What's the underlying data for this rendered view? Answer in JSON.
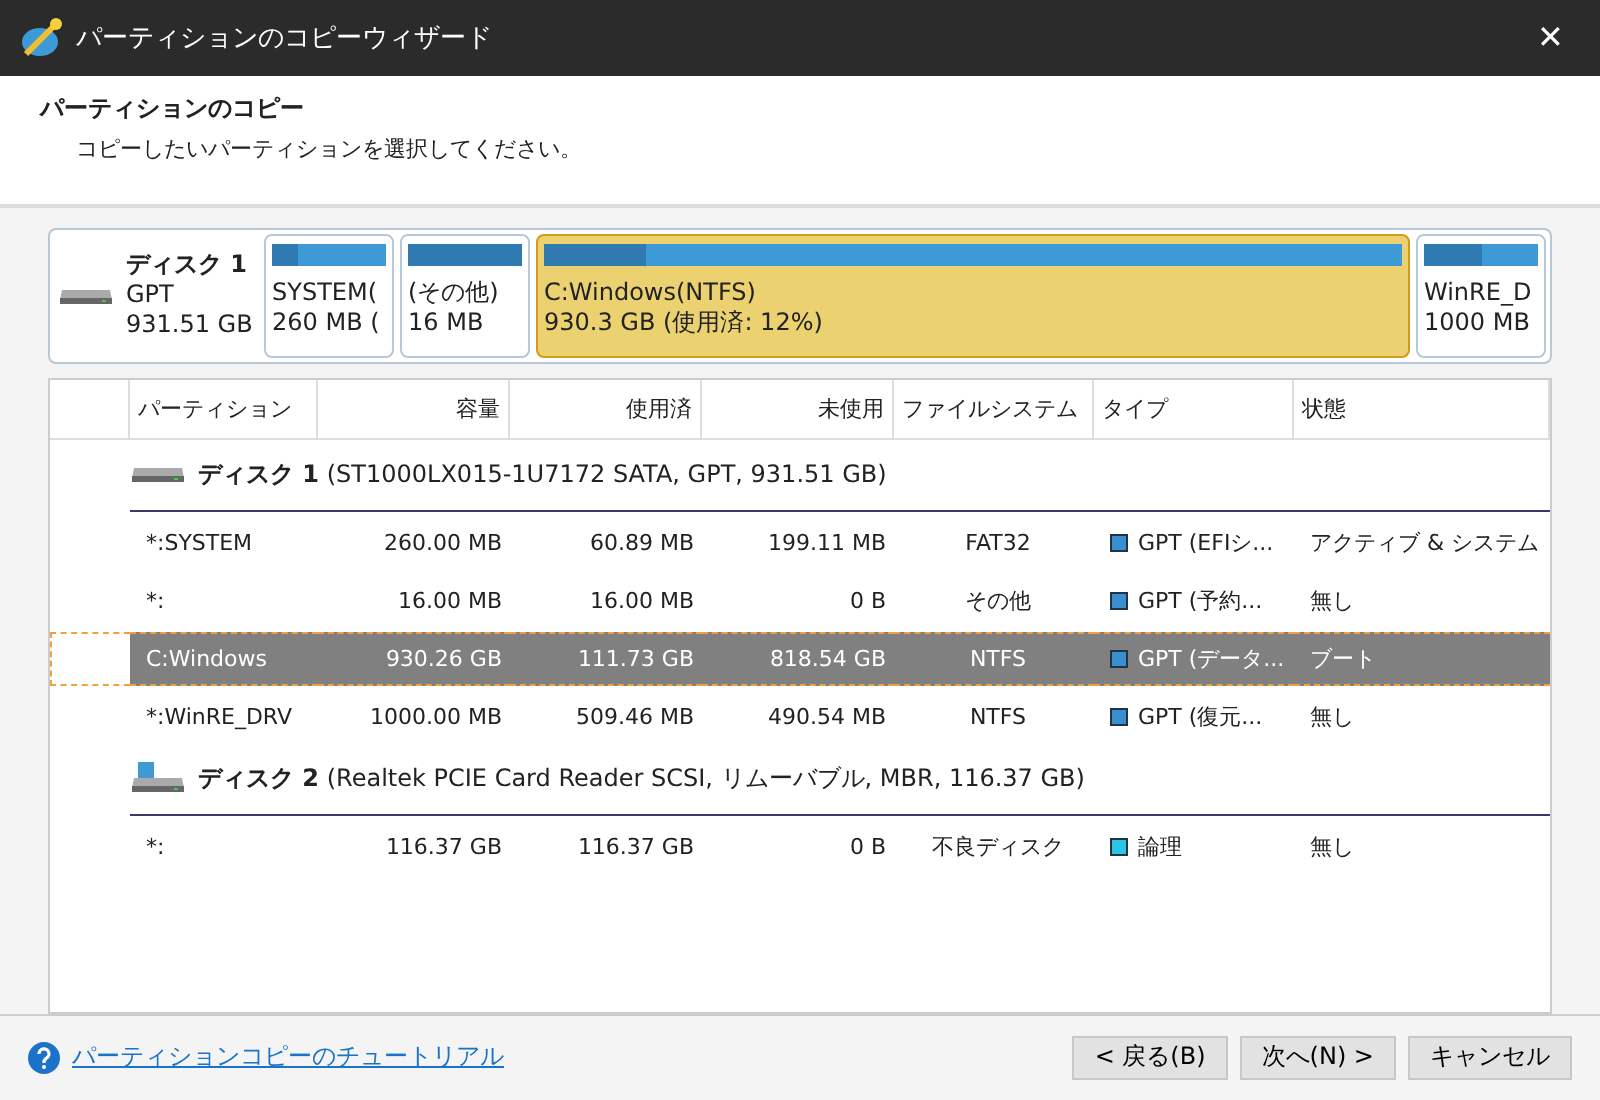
{
  "window": {
    "title": "パーティションのコピーウィザード",
    "close": "✕"
  },
  "header": {
    "title": "パーティションのコピー",
    "subtitle": "コピーしたいパーティションを選択してください。"
  },
  "disk_map": {
    "name": "ディスク 1",
    "style": "GPT",
    "size": "931.51 GB",
    "partitions": [
      {
        "label": "SYSTEM(",
        "size": "260 MB (",
        "level": 0.23,
        "selected": false
      },
      {
        "label": "(その他)",
        "size": "16 MB",
        "level": 1.0,
        "selected": false
      },
      {
        "label": "C:Windows(NTFS)",
        "size": "930.3 GB (使用済: 12%)",
        "level": 0.12,
        "selected": true
      },
      {
        "label": "WinRE_D",
        "size": "1000 MB",
        "level": 0.51,
        "selected": false
      }
    ]
  },
  "table": {
    "columns": [
      "パーティション",
      "容量",
      "使用済",
      "未使用",
      "ファイルシステム",
      "タイプ",
      "状態"
    ],
    "rows": [
      {
        "kind": "disk",
        "name": "ディスク 1",
        "detail": "(ST1000LX015-1U7172 SATA, GPT, 931.51 GB)"
      },
      {
        "kind": "partition",
        "selected": false,
        "cells": [
          "*:SYSTEM",
          "260.00 MB",
          "60.89 MB",
          "199.11 MB",
          "FAT32",
          "GPT (EFIシ...",
          "アクティブ & システム"
        ],
        "color": "#3a8fd0"
      },
      {
        "kind": "partition",
        "selected": false,
        "cells": [
          "*:",
          "16.00 MB",
          "16.00 MB",
          "0 B",
          "その他",
          "GPT (予約...",
          "無し"
        ],
        "color": "#3a8fd0"
      },
      {
        "kind": "partition",
        "selected": true,
        "cells": [
          "C:Windows",
          "930.26 GB",
          "111.73 GB",
          "818.54 GB",
          "NTFS",
          "GPT (データ...",
          "ブート"
        ],
        "color": "#3a8fd0"
      },
      {
        "kind": "partition",
        "selected": false,
        "cells": [
          "*:WinRE_DRV",
          "1000.00 MB",
          "509.46 MB",
          "490.54 MB",
          "NTFS",
          "GPT (復元...",
          "無し"
        ],
        "color": "#3a8fd0"
      },
      {
        "kind": "removable_disk",
        "name": "ディスク 2",
        "detail": "(Realtek PCIE Card Reader SCSI, リムーバブル, MBR, 116.37 GB)"
      },
      {
        "kind": "partition",
        "selected": false,
        "cells": [
          "*:",
          "116.37 GB",
          "116.37 GB",
          "0 B",
          "不良ディスク",
          "論理",
          "無し"
        ],
        "color": "#2cc4e8"
      }
    ]
  },
  "footer": {
    "help_link": "パーティションコピーのチュートリアル",
    "buttons": [
      "< 戻る(B)",
      "次へ(N) >",
      "キャンセル"
    ]
  }
}
